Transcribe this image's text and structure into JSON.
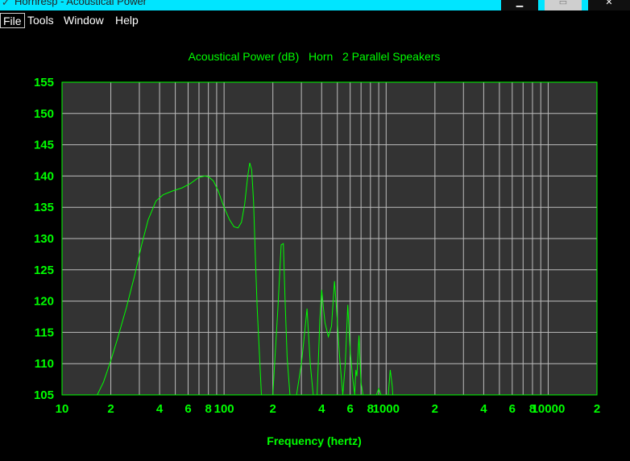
{
  "window": {
    "title": "Hornresp - Acoustical Power",
    "min_glyph": "▁",
    "max_glyph": "▭",
    "close_glyph": "✕"
  },
  "menu": [
    {
      "label": "File"
    },
    {
      "label": "Tools"
    },
    {
      "label": "Window"
    },
    {
      "label": "Help"
    }
  ],
  "colors": {
    "background": "#000000",
    "plot": "#333333",
    "grid": "#bdbdbd",
    "accent": "#00ff00",
    "frame": "#00e5ff"
  },
  "chart_data": {
    "type": "line",
    "title": "Acoustical Power (dB)   Horn   2 Parallel Speakers",
    "xlabel": "Frequency (hertz)",
    "ylabel": "",
    "xscale": "log",
    "xlim": [
      10,
      20000
    ],
    "ylim": [
      105,
      155
    ],
    "grid": true,
    "y_ticks": [
      155,
      150,
      145,
      140,
      135,
      130,
      125,
      120,
      115,
      110,
      105
    ],
    "x_ticks": [
      {
        "value": 10,
        "label": "10"
      },
      {
        "value": 20,
        "label": "2"
      },
      {
        "value": 40,
        "label": "4"
      },
      {
        "value": 60,
        "label": "6"
      },
      {
        "value": 80,
        "label": "8"
      },
      {
        "value": 100,
        "label": "100"
      },
      {
        "value": 200,
        "label": "2"
      },
      {
        "value": 400,
        "label": "4"
      },
      {
        "value": 600,
        "label": "6"
      },
      {
        "value": 800,
        "label": "8"
      },
      {
        "value": 1000,
        "label": "1000"
      },
      {
        "value": 2000,
        "label": "2"
      },
      {
        "value": 4000,
        "label": "4"
      },
      {
        "value": 6000,
        "label": "6"
      },
      {
        "value": 8000,
        "label": "8"
      },
      {
        "value": 10000,
        "label": "10000"
      },
      {
        "value": 20000,
        "label": "2"
      }
    ],
    "series": [
      {
        "color": "#00ff00",
        "x": [
          16.5,
          18,
          20,
          22,
          25,
          28,
          31,
          34,
          38,
          42,
          48,
          55,
          62,
          70,
          76,
          80,
          86,
          92,
          100,
          108,
          115,
          122,
          128,
          134,
          140,
          144,
          148,
          152,
          156,
          160,
          170,
          185,
          200,
          205,
          215,
          225,
          232,
          238,
          245,
          255,
          265,
          280,
          300,
          310,
          325,
          340,
          355,
          365,
          375,
          385,
          390,
          400,
          410,
          420,
          440,
          460,
          480,
          495,
          510,
          520,
          540,
          560,
          580,
          600,
          620,
          640,
          650,
          660,
          680,
          700,
          720,
          750,
          780,
          820,
          870,
          900,
          930,
          950,
          980,
          1000,
          1030,
          1060,
          1090,
          1100,
          1150
        ],
        "y": [
          105,
          107,
          110.5,
          114,
          119,
          124,
          129,
          133,
          136,
          137,
          137.6,
          138.1,
          138.8,
          139.8,
          140,
          139.9,
          139.2,
          137.6,
          135,
          133,
          131.9,
          131.7,
          132.6,
          135.5,
          140,
          142.1,
          141,
          136,
          127,
          119,
          105,
          105,
          105,
          110,
          119,
          129,
          129.2,
          120,
          111,
          105,
          105,
          105,
          110,
          113.5,
          118.8,
          110,
          105,
          105,
          105,
          113,
          117,
          121.8,
          119,
          116.5,
          114.3,
          116,
          123.2,
          118.5,
          113,
          110,
          105,
          110,
          119.4,
          112,
          108,
          105,
          109,
          108,
          114.5,
          107,
          105,
          105,
          105,
          105,
          105,
          106,
          105,
          105,
          105,
          105,
          105,
          109,
          106.5,
          105,
          105
        ]
      }
    ]
  }
}
